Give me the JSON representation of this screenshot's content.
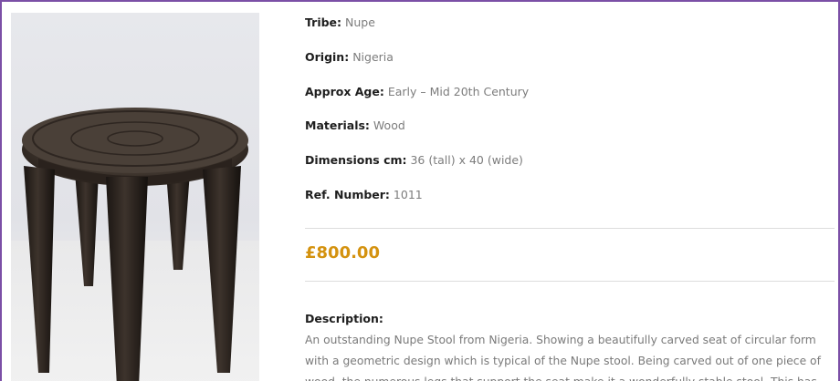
{
  "product": {
    "image_alt": "Nupe stool photograph",
    "specs": [
      {
        "key": "Tribe:",
        "value": "Nupe"
      },
      {
        "key": "Origin:",
        "value": "Nigeria"
      },
      {
        "key": "Approx Age:",
        "value": "Early – Mid 20th Century"
      },
      {
        "key": "Materials:",
        "value": "Wood"
      },
      {
        "key": "Dimensions cm:",
        "value": "36 (tall) x 40 (wide)"
      },
      {
        "key": "Ref. Number:",
        "value": "1011"
      }
    ],
    "price": "£800.00",
    "description_heading": "Description:",
    "description_text": "An outstanding Nupe Stool from Nigeria. Showing a beautifully carved seat of circular form\nwith a geometric design which is typical of the Nupe stool. Being carved out of one piece of\nwood, the numerous legs that support the seat make it a wonderfully stable stool. This has"
  },
  "colors": {
    "frame": "#7b4fa6",
    "price": "#d4920f",
    "label": "#1e1e1e",
    "value": "#7c7c7c"
  }
}
